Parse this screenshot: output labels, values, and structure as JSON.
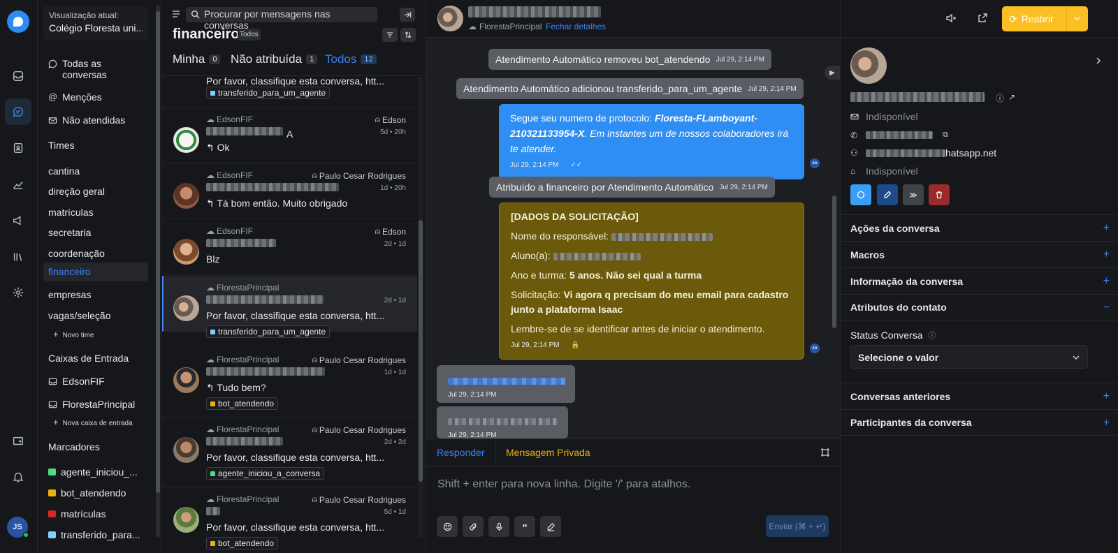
{
  "sidebar": {
    "current_view_label": "Visualização atual:",
    "current_view_value": "Colégio Floresta uni...",
    "nav": [
      {
        "label": "Todas as conversas"
      },
      {
        "label": "Menções"
      },
      {
        "label": "Não atendidas"
      }
    ],
    "teams_heading": "Times",
    "teams": [
      "cantina",
      "direção geral",
      "matrículas",
      "secretaria",
      "coordenação",
      "financeiro",
      "empresas",
      "vagas/seleção"
    ],
    "new_team": "Novo time",
    "inboxes_heading": "Caixas de Entrada",
    "inboxes": [
      "EdsonFIF",
      "FlorestaPrincipal"
    ],
    "new_inbox": "Nova caixa de entrada",
    "labels_heading": "Marcadores",
    "labels": [
      {
        "name": "agente_iniciou_...",
        "color": "#4ade80"
      },
      {
        "name": "bot_atendendo",
        "color": "#eab308"
      },
      {
        "name": "matrículas",
        "color": "#dc2626"
      },
      {
        "name": "transferido_para...",
        "color": "#7dd3fc"
      }
    ],
    "user_initials": "JS"
  },
  "list": {
    "search_placeholder": "Procurar por mensagens nas conversas",
    "title": "financeiro",
    "filter": "Todos",
    "tabs": [
      {
        "label": "Minha",
        "count": "0"
      },
      {
        "label": "Não atribuída",
        "count": "1"
      },
      {
        "label": "Todos",
        "count": "12"
      }
    ],
    "top_partial": {
      "msg": "Por favor, classifique esta conversa, htt...",
      "label": "transferido_para_um_agente"
    },
    "conversations": [
      {
        "inbox": "EdsonFIF",
        "agent": "Edson",
        "time": "5d • 20h",
        "msg": "↰ Ok",
        "name_tail": "A"
      },
      {
        "inbox": "EdsonFIF",
        "agent": "Paulo Cesar Rodrigues",
        "time": "1d • 20h",
        "msg": "↰ Tá bom então. Muito obrigado"
      },
      {
        "inbox": "EdsonFIF",
        "agent": "Edson",
        "time": "2d • 1d",
        "msg": "Blz"
      },
      {
        "inbox": "FlorestaPrincipal",
        "agent": "",
        "time": "2d • 1d",
        "msg": "Por favor, classifique esta conversa, htt...",
        "label": "transferido_para_um_agente"
      },
      {
        "inbox": "FlorestaPrincipal",
        "agent": "Paulo Cesar Rodrigues",
        "time": "1d • 1d",
        "msg": "↰ Tudo bem?",
        "label": "bot_atendendo"
      },
      {
        "inbox": "FlorestaPrincipal",
        "agent": "Paulo Cesar Rodrigues",
        "time": "2d • 2d",
        "msg": "Por favor, classifique esta conversa, htt...",
        "label": "agente_iniciou_a_conversa"
      },
      {
        "inbox": "FlorestaPrincipal",
        "agent": "Paulo Cesar Rodrigues",
        "time": "5d • 1d",
        "msg": "Por favor, classifique esta conversa, htt...",
        "label": "bot_atendendo"
      }
    ]
  },
  "chat": {
    "inbox": "FlorestaPrincipal",
    "close_details": "Fechar detalhes",
    "activities": [
      {
        "text": "Atendimento Automático removeu bot_atendendo",
        "time": "Jul 29, 2:14 PM"
      },
      {
        "text": "Atendimento Automático adicionou transferido_para_um_agente",
        "time": "Jul 29, 2:14 PM"
      },
      {
        "text": "Atribuído a financeiro por Atendimento Automático",
        "time": "Jul 29, 2:14 PM"
      }
    ],
    "protocol_msg": {
      "prefix": "Segue seu numero de protocolo: ",
      "protocol": "Floresta-FLamboyant-210321133954-X",
      "suffix": ". Em instantes um de nossos colaboradores irá te atender.",
      "time": "Jul 29, 2:14 PM"
    },
    "private_msg": {
      "heading": "[DADOS DA SOLICITAÇÃO]",
      "responsavel_label": "Nome do responsável: ",
      "aluno_label": "Aluno(a): ",
      "ano_label": "Ano e turma: ",
      "ano_value": "5 anos. Não sei qual a turma",
      "solic_label": "Solicitação: ",
      "solic_value": "Vi agora q precisam do meu email para cadastro junto a plataforma Isaac",
      "footer": "Lembre-se de se identificar antes de iniciar o atendimento.",
      "time": "Jul 29, 2:14 PM"
    },
    "incoming": [
      {
        "time": "Jul 29, 2:14 PM"
      },
      {
        "time": "Jul 29, 2:14 PM"
      }
    ],
    "agent_badge": "AA",
    "composer": {
      "reply_tab": "Responder",
      "private_tab": "Mensagem Privada",
      "placeholder": "Shift + enter para nova linha. Digite '/' para atalhos.",
      "send": "Enviar (⌘ + ↵)"
    }
  },
  "contact": {
    "reopen": "Reabrir",
    "email": "Indisponível",
    "whatsapp_tail": "hatsapp.net",
    "company": "Indisponível",
    "sections": [
      "Ações da conversa",
      "Macros",
      "Informação da conversa",
      "Atributos do contato",
      "Conversas anteriores",
      "Participantes da conversa"
    ],
    "attr_label": "Status Conversa",
    "attr_select": "Selecione o valor"
  }
}
